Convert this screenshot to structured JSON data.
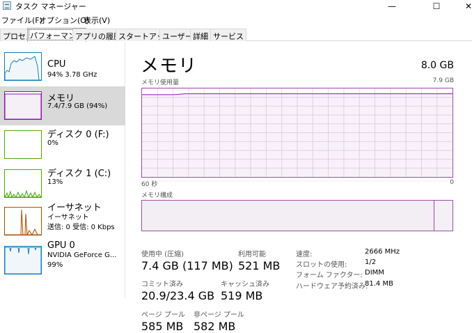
{
  "window": {
    "title": "タスク マネージャー",
    "min_glyph": "—",
    "max_glyph": "☐",
    "close_glyph": "✕"
  },
  "menu": [
    "ファイル(F)",
    "オプション(O)",
    "表示(V)"
  ],
  "tabs": [
    "プロセス",
    "パフォーマンス",
    "アプリの履歴",
    "スタートアップ",
    "ユーザー",
    "詳細",
    "サービス"
  ],
  "active_tab_index": 1,
  "sidebar": [
    {
      "name": "CPU",
      "sub": "94%  3.78 GHz",
      "color": "#117dbb"
    },
    {
      "name": "メモリ",
      "sub": "7.4/7.9 GB (94%)",
      "color": "#8b12ae",
      "selected": true
    },
    {
      "name": "ディスク 0 (F:)",
      "sub": "0%",
      "color": "#4da60c"
    },
    {
      "name": "ディスク 1 (C:)",
      "sub": "13%",
      "color": "#4da60c"
    },
    {
      "name": "イーサネット",
      "sub": "イーサネット",
      "sub2": "送信: 0 受信: 0 Kbps",
      "color": "#a74f01"
    },
    {
      "name": "GPU 0",
      "sub": "NVIDIA GeForce G...",
      "sub2": "99%",
      "color": "#117dbb"
    }
  ],
  "main": {
    "title": "メモリ",
    "capacity": "8.0 GB",
    "usage_label": "メモリ使用量",
    "usage_max": "7.9 GB",
    "time_left": "60 秒",
    "time_right": "0",
    "composition_label": "メモリ構成",
    "stats": [
      {
        "label": "使用中 (圧縮)",
        "value": "7.4 GB (117 MB)"
      },
      {
        "label": "利用可能",
        "value": "521 MB"
      },
      {
        "label": "コミット済み",
        "value": "20.9/23.4 GB"
      },
      {
        "label": "キャッシュ済み",
        "value": "519 MB"
      },
      {
        "label": "ページ プール",
        "value": "585 MB"
      },
      {
        "label": "非ページ プール",
        "value": "582 MB"
      }
    ],
    "details": [
      {
        "key": "速度:",
        "value": "2666 MHz"
      },
      {
        "key": "スロットの使用:",
        "value": "1/2"
      },
      {
        "key": "フォーム ファクター:",
        "value": "DIMM"
      },
      {
        "key": "ハードウェア予約済み:",
        "value": "81.4 MB"
      }
    ]
  },
  "chart_data": {
    "type": "area",
    "series": [
      {
        "values": [
          0.93,
          0.93,
          0.93,
          0.93,
          0.94,
          0.94,
          0.94,
          0.94,
          0.94,
          0.94,
          0.94,
          0.94,
          0.94,
          0.94,
          0.94,
          0.94,
          0.94,
          0.94,
          0.94,
          0.94,
          0.94,
          0.94,
          0.94,
          0.94,
          0.94,
          0.94,
          0.94,
          0.94,
          0.94,
          0.94
        ]
      }
    ],
    "x_range": [
      60,
      0
    ],
    "ylim": [
      0,
      7.9
    ],
    "grid": true
  }
}
